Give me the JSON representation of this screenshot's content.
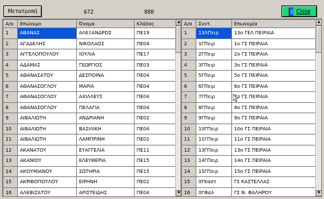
{
  "toolbar": {
    "convert_button": "Μετατροπή",
    "count_left": "672",
    "count_right": "888",
    "close_button": "Close",
    "close_icon": "door-exit-icon"
  },
  "left_table": {
    "headers": [
      "Α/α",
      "Επώνυμο",
      "Όνομα",
      "Κλάδος"
    ],
    "rows": [
      [
        "1",
        "ΑΒΑΝΑΣ",
        "ΑΛΕΞΑΝΔΡΟΣ",
        "ΠΕ19"
      ],
      [
        "2",
        "ΑΓΑΔΕΛΗΣ",
        "ΝΙΚΟΛΑΟΣ",
        "ΠΕ04"
      ],
      [
        "3",
        "ΑΓΓΕΛΟΠΟΥΛΟΥ",
        "ΙΟΥΛΙΑ",
        "ΠΕ17"
      ],
      [
        "4",
        "ΑΔΑΜΑΣ",
        "ΓΕΩΡΓΙΟΣ",
        "ΠΕ03"
      ],
      [
        "5",
        "ΑΘΑΝΑΣΑΤΟΥ",
        "ΔΕΣΠΟΙΝΑ",
        "ΠΕ04"
      ],
      [
        "6",
        "ΑΘΑΝΑΣΟΓΛΟΥ",
        "ΜΑΡΙΑ",
        "ΠΕ04"
      ],
      [
        "7",
        "ΑΘΑΝΑΣΟΓΛΟΥ",
        "ΑΧΙΛΛΕΥΣ",
        "ΠΕ04"
      ],
      [
        "8",
        "ΑΘΑΝΑΣΟΓΛΟΥ",
        "ΠΕΛΑΓΙΑ",
        "ΠΕ04"
      ],
      [
        "9",
        "ΑΙΒΑΛΙΩΤΗ",
        "ΑΝΔΡΙΑΝΗ",
        "ΠΕ02"
      ],
      [
        "10",
        "ΑΙΒΑΛΙΩΤΗ",
        "ΒΑΣΙΛΙΚΗ",
        "ΠΕ04"
      ],
      [
        "11",
        "ΑΙΒΑΛΙΩΤΗ",
        "ΛΑΜΠΡΙΝΗ",
        "ΠΕ02"
      ],
      [
        "12",
        "ΑΚΑΝΑΤΟΥ",
        "ΕΥΑΓΓΕΛΙΑ",
        "ΠΕ11"
      ],
      [
        "13",
        "ΑΚΑΝΙΟΥ",
        "ΕΛΕΥΘΕΡΙΑ",
        "ΠΕ15"
      ],
      [
        "14",
        "ΑΚΟΥΜΙΑΝΟΥ",
        "ΣΩΤΗΡΙΑ",
        "ΠΕ15"
      ],
      [
        "15",
        "ΑΚΡΙΒΟΠΟΥΛΟΥ",
        "ΕΙΡΗΝΗ",
        "ΠΕ02"
      ],
      [
        "16",
        "ΑΛΕΒΙΖΑΤΟΥ",
        "ΑΡΙΣΤΕΙΔΗΣ",
        "ΠΕ04"
      ]
    ]
  },
  "right_table": {
    "headers": [
      "Α/α",
      "Συντ.",
      "Επωνυμία"
    ],
    "rows": [
      [
        "1",
        "13ΛΠειρ",
        "13ο ΓΕΛ ΠΕΙΡΑΙΑ"
      ],
      [
        "2",
        "1ΓΠειρ",
        "1ο ΓΣ ΠΕΙΡΑΙΑ"
      ],
      [
        "3",
        "2ΓΠειρ",
        "2ο ΓΣ ΠΕΙΡΑΙΑ"
      ],
      [
        "4",
        "3ΓΠειρ",
        "3ο ΓΣ ΠΕΙΡΑΙΑ"
      ],
      [
        "5",
        "5ΓΠειρ",
        "5ο ΓΣ ΠΕΙΡΑΙΑ"
      ],
      [
        "6",
        "6ΓΠειρ",
        "6ο ΓΣ ΠΕΙΡΑΙΑ"
      ],
      [
        "7",
        "7ΓΠειρ",
        "7ο ΓΣ ΠΕΙΡΑΙΑ"
      ],
      [
        "8",
        "8ΓΠειρ",
        "8ο ΓΣ ΠΕΙΡΑΙΑ"
      ],
      [
        "9",
        "9ΓΠειρ",
        "9ο ΓΣ ΠΕΙΡΑΙΑ"
      ],
      [
        "10",
        "10ΓΠειρ",
        "10ο ΓΣ ΠΕΙΡΑΙΑ"
      ],
      [
        "11",
        "11ΓΠειρ",
        "11ο ΓΣ ΠΕΙΡΑΙΑ"
      ],
      [
        "12",
        "13ΓΠειρ",
        "13ο ΓΣ ΠΕΙΡΑΙΑ"
      ],
      [
        "13",
        "14ΓΠειρ",
        "14ο ΓΣ ΠΕΙΡΑΙΑ"
      ],
      [
        "14",
        "15ΓΠειρ",
        "15ο ΓΣ ΠΕΙΡΑΙΑ"
      ],
      [
        "15",
        "0ΓΚαστ",
        "ΓΣ ΚΑΣΤΕΛΛΑΣ"
      ],
      [
        "16",
        "0ΓΦαλ",
        "ΓΣ Ν. ΦΑΛΗΡΟΥ"
      ]
    ]
  },
  "colors": {
    "selection": "#0a54d8",
    "close_button": "#1fd67a",
    "window_bg": "#d4d0c8"
  }
}
